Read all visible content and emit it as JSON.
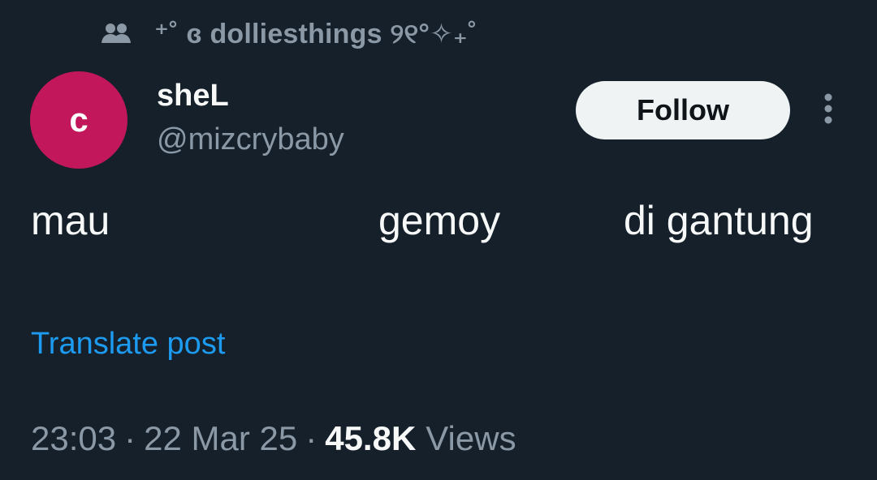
{
  "context": {
    "icon": "community-icon",
    "label": "⁺˚ ɞ dolliesthings ୨୧°✧₊˚"
  },
  "author": {
    "avatar_initial": "c",
    "avatar_color": "#c2185b",
    "display_name": "sheL",
    "handle": "@mizcrybaby"
  },
  "actions": {
    "follow_label": "Follow",
    "more_icon": "more-vertical-icon"
  },
  "post": {
    "words": [
      "mau",
      "gemoy",
      "di gantung"
    ]
  },
  "translate_label": "Translate post",
  "meta": {
    "time": "23:03",
    "separator": "·",
    "date": "22 Mar 25",
    "views_count": "45.8K",
    "views_label": "Views"
  },
  "colors": {
    "background": "#15202b",
    "primary_text": "#f7f9f9",
    "secondary_text": "#8b98a5",
    "link": "#1d9bf0",
    "follow_bg": "#eff3f4"
  }
}
